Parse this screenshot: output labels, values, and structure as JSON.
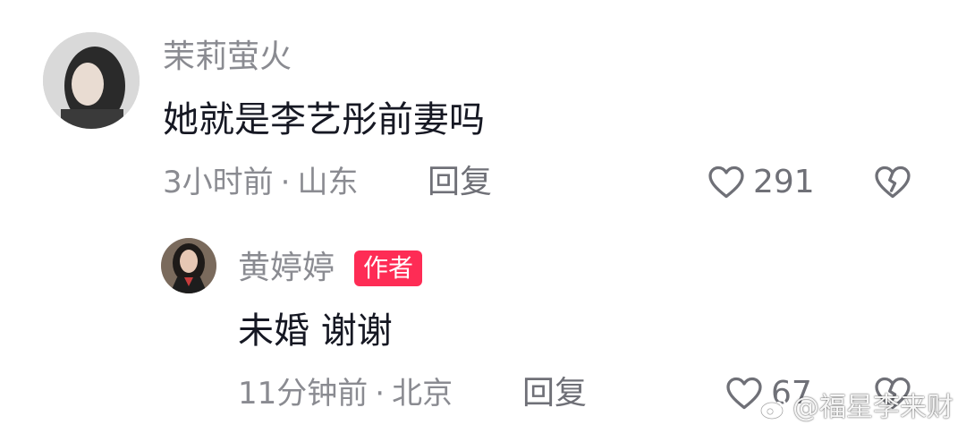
{
  "comments": [
    {
      "username": "茉莉萤火",
      "text": "她就是李艺彤前妻吗",
      "time": "3小时前",
      "separator": "·",
      "location": "山东",
      "reply_label": "回复",
      "likes": "291",
      "avatar_icon": "user-avatar",
      "like_icon": "heart-outline-icon",
      "dislike_icon": "broken-heart-icon"
    },
    {
      "username": "黄婷婷",
      "badge": "作者",
      "text": "未婚 谢谢",
      "time": "11分钟前",
      "separator": "·",
      "location": "北京",
      "reply_label": "回复",
      "likes": "67",
      "avatar_icon": "user-avatar",
      "like_icon": "heart-outline-icon",
      "dislike_icon": "broken-heart-icon"
    }
  ],
  "watermark": {
    "text": "@福星李来财",
    "icon": "weibo-logo-icon"
  },
  "colors": {
    "badge_bg": "#fe2c55",
    "secondary_text": "#8a8b91",
    "primary_text": "#161823"
  }
}
